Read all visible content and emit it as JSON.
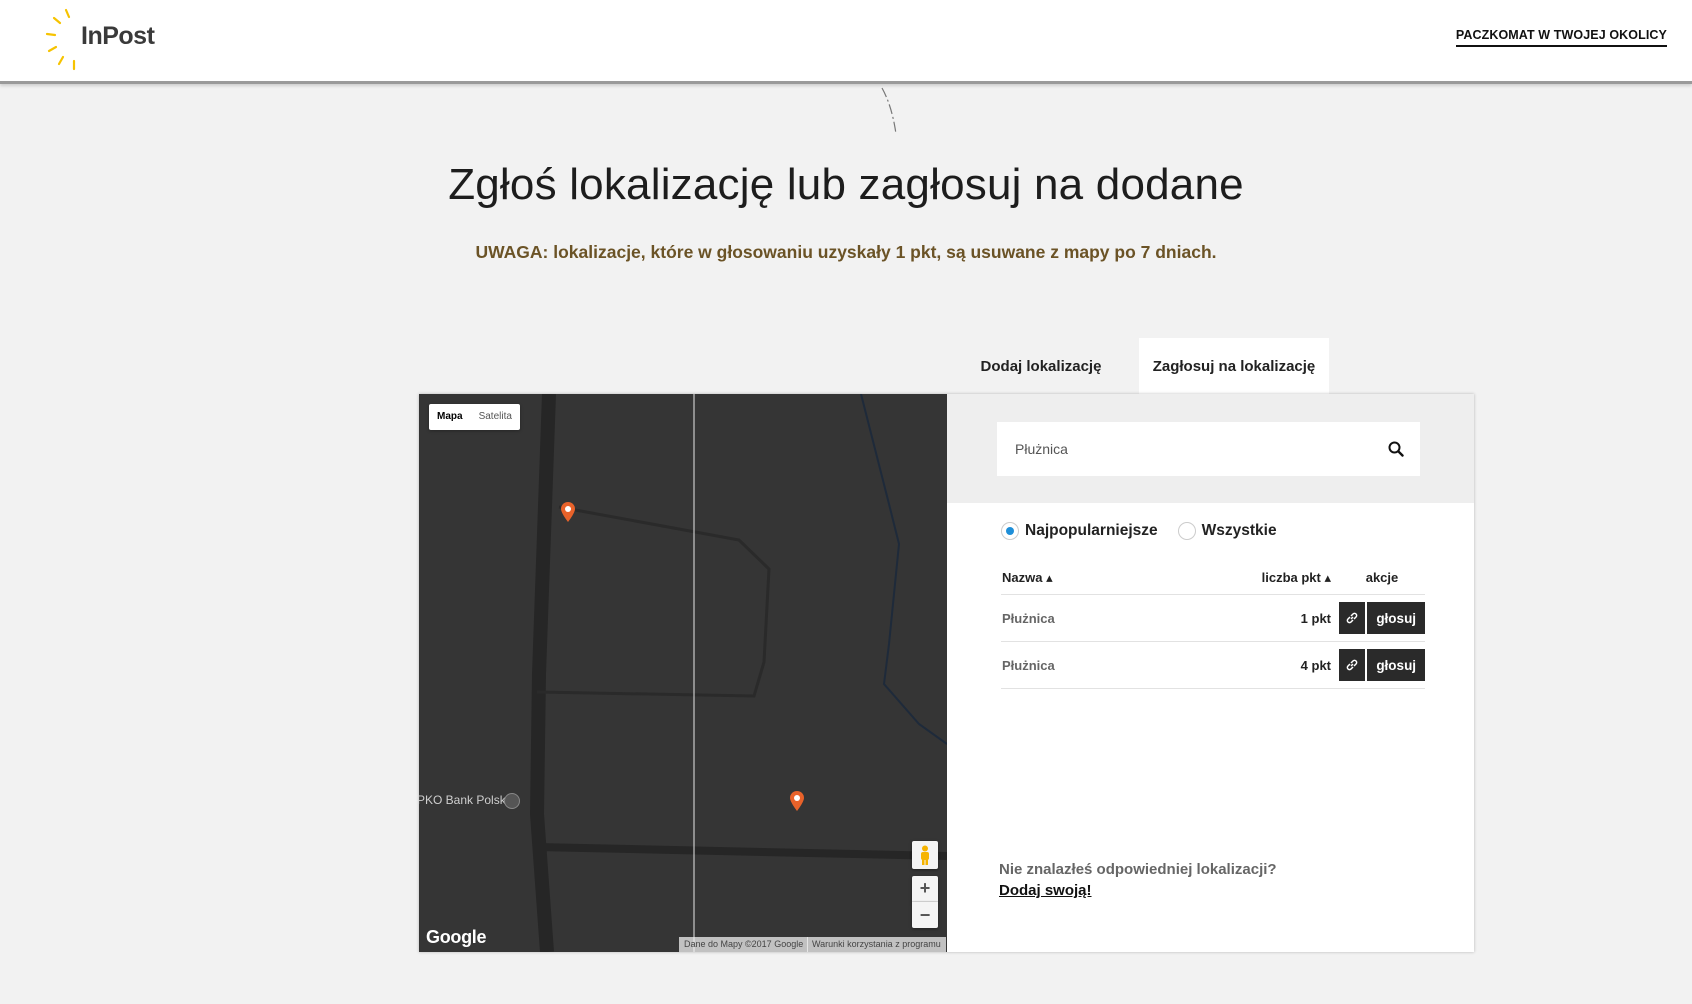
{
  "header": {
    "brand": "InPost",
    "nav_link": "PACZKOMAT W TWOJEJ OKOLICY"
  },
  "page": {
    "title": "Zgłoś lokalizację lub zagłosuj na dodane",
    "notice": "UWAGA: lokalizacje, które w głosowaniu uzyskały 1 pkt, są usuwane z mapy po 7 dniach."
  },
  "tabs": [
    {
      "label": "Dodaj lokalizację",
      "active": false
    },
    {
      "label": "Zagłosuj na lokalizację",
      "active": true
    }
  ],
  "map": {
    "type_map": "Mapa",
    "type_satellite": "Satelita",
    "poi_label": "PKO Bank Polski",
    "zoom_in": "+",
    "zoom_out": "−",
    "google": "Google",
    "attribution": "Dane do Mapy ©2017 Google",
    "terms": "Warunki korzystania z programu"
  },
  "search": {
    "value": "Płużnica",
    "placeholder": ""
  },
  "filters": {
    "popular": "Najpopularniejsze",
    "all": "Wszystkie",
    "selected": "popular"
  },
  "table": {
    "headers": {
      "name": "Nazwa ▴",
      "points": "liczba pkt ▴",
      "actions": "akcje"
    },
    "rows": [
      {
        "name": "Płużnica",
        "points": "1 pkt",
        "vote_label": "głosuj"
      },
      {
        "name": "Płużnica",
        "points": "4 pkt",
        "vote_label": "głosuj"
      }
    ]
  },
  "footer_prompt": {
    "question": "Nie znalazłeś odpowiedniej lokalizacji?",
    "link": "Dodaj swoją!"
  },
  "colors": {
    "accent_yellow": "#f6c300",
    "pin_orange": "#e8622a",
    "notice_brown": "#6b5326",
    "dark_button": "#2a2a2a",
    "radio_blue": "#1f8fd8"
  }
}
